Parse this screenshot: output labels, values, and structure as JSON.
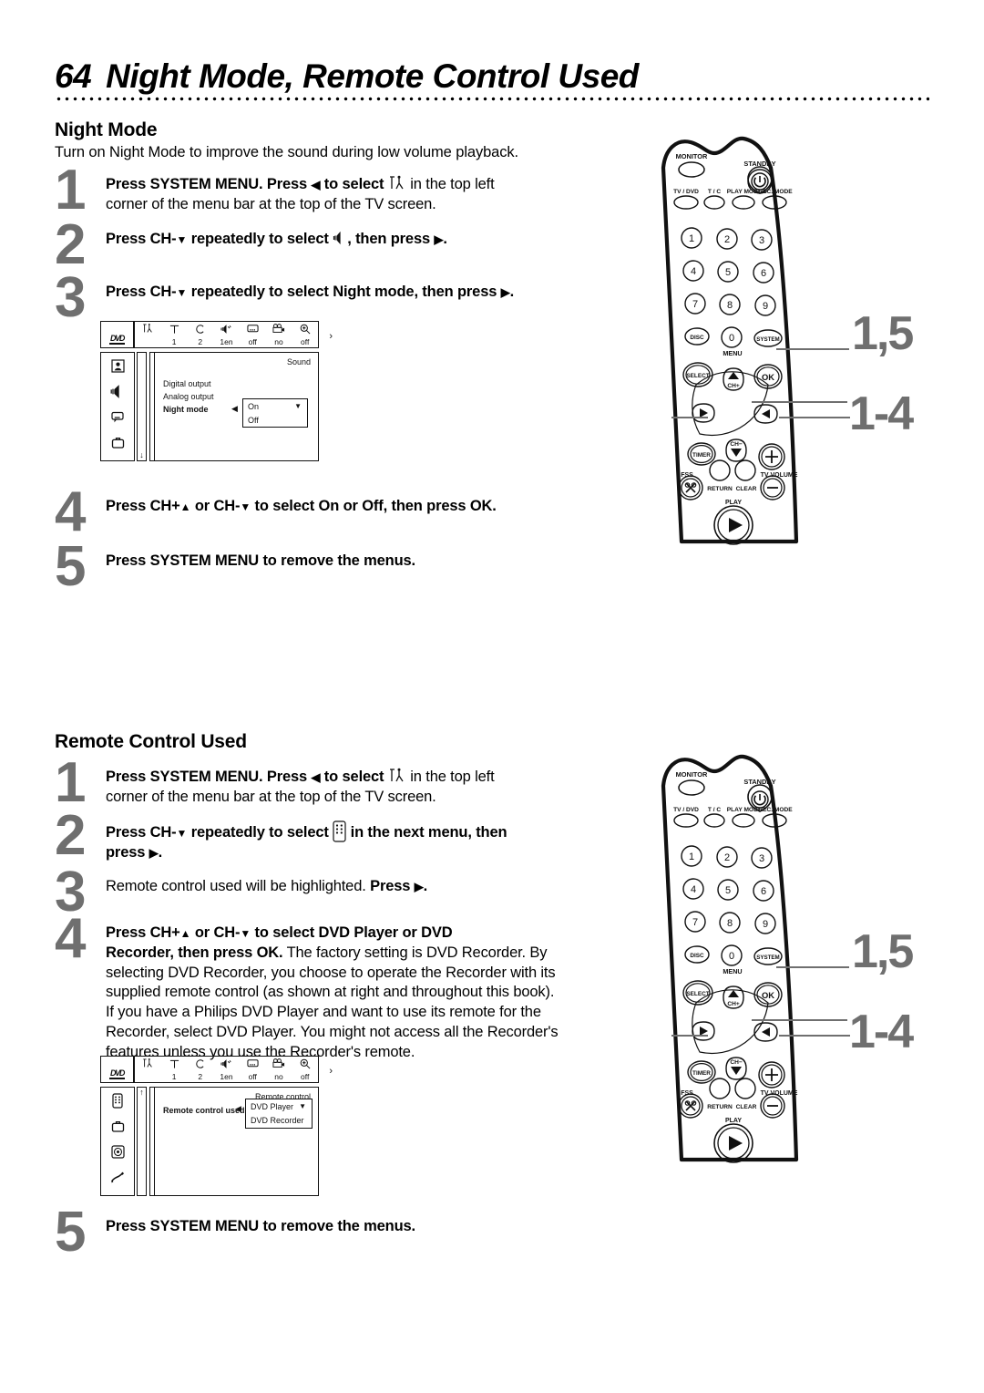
{
  "page": {
    "number": "64",
    "title": "Night Mode, Remote Control Used"
  },
  "sections": [
    {
      "id": "night_mode",
      "title": "Night Mode",
      "intro": "Turn on Night Mode to improve the sound during low volume playback."
    },
    {
      "id": "remote_control_used",
      "title": "Remote Control Used"
    }
  ],
  "night_mode_steps": {
    "s1_num": "1",
    "s1_a": "Press SYSTEM MENU. Press ",
    "s1_b": " to select ",
    "s1_c": " in the top left",
    "s1_d": "corner of the menu bar at the top of the TV screen.",
    "s2_num": "2",
    "s2_a": "Press CH-",
    "s2_b": " repeatedly to select ",
    "s2_c": ", then press ",
    "s2_d": ".",
    "s3_num": "3",
    "s3_a": "Press CH-",
    "s3_b": " repeatedly to select Night mode, then press ",
    "s3_c": ".",
    "s4_num": "4",
    "s4_a": "Press CH+",
    "s4_b": " or CH-",
    "s4_c": " to select On or Off, then press OK.",
    "s5_num": "5",
    "s5_a": "Press SYSTEM MENU",
    "s5_b": " to remove the menus."
  },
  "remote_used_steps": {
    "s1_num": "1",
    "s1_a": "Press SYSTEM MENU. Press ",
    "s1_b": " to select ",
    "s1_c": " in the top left",
    "s1_d": "corner of the menu bar at the top of the TV screen.",
    "s2_num": "2",
    "s2_a": "Press CH-",
    "s2_b": " repeatedly to select ",
    "s2_c": " in the next menu, then",
    "s2_d": "press ",
    "s2_e": ".",
    "s3_num": "3",
    "s3_a": "Remote control used will be highlighted. ",
    "s3_b": "Press ",
    "s3_c": ".",
    "s4_num": "4",
    "s4_a": "Press CH+",
    "s4_b": " or CH-",
    "s4_c": " to select DVD Player or DVD",
    "s4_d": "Recorder, then press OK.",
    "s4_e": " The factory setting is DVD Recorder. By selecting DVD Recorder, you choose to operate the Recorder with its supplied remote control (as shown at right and throughout this book). If you have a Philips DVD Player and want to use its remote for the Recorder, select DVD Player. You might not access all the Recorder's features unless you use the Recorder's remote.",
    "s5_num": "5",
    "s5_a": "Press SYSTEM MENU",
    "s5_b": " to remove the menus."
  },
  "tv_menu_sound": {
    "logo": "DVD",
    "bar_columns": [
      {
        "icon": "tools-icon",
        "value": ""
      },
      {
        "icon": "title-T-icon",
        "value": "1"
      },
      {
        "icon": "chapter-C-icon",
        "value": "2"
      },
      {
        "icon": "audio-language-icon",
        "value": "1en"
      },
      {
        "icon": "subtitle-icon",
        "value": "off"
      },
      {
        "icon": "camera-angle-icon",
        "value": "no"
      },
      {
        "icon": "zoom-icon",
        "value": "off"
      }
    ],
    "bar_more": "›",
    "sidebar_icons": [
      "picture-icon",
      "sound-speaker-icon",
      "language-bubble-icon",
      "features-box-icon"
    ],
    "sidebar_selected_index": 1,
    "scroll_top": "",
    "scroll_bottom": "↓",
    "heading": "Sound",
    "rows": [
      "Digital output",
      "Analog output",
      "Night mode"
    ],
    "selected_row": "Night mode",
    "select_arrow": "◀",
    "dropdown_options": [
      "On",
      "Off"
    ],
    "dropdown_caret": "▼"
  },
  "tv_menu_remote": {
    "logo": "DVD",
    "bar_columns": [
      {
        "icon": "tools-icon",
        "value": ""
      },
      {
        "icon": "title-T-icon",
        "value": "1"
      },
      {
        "icon": "chapter-C-icon",
        "value": "2"
      },
      {
        "icon": "audio-language-icon",
        "value": "1en"
      },
      {
        "icon": "subtitle-icon",
        "value": "off"
      },
      {
        "icon": "camera-angle-icon",
        "value": "no"
      },
      {
        "icon": "zoom-icon",
        "value": "off"
      }
    ],
    "bar_more": "›",
    "sidebar_icons": [
      "remote-control-icon",
      "features-box-icon",
      "disc-icon",
      "wrench-icon"
    ],
    "sidebar_selected_index": 0,
    "scroll_top": "↑",
    "scroll_bottom": "",
    "heading": "Remote control",
    "rows": [
      "Remote control used"
    ],
    "selected_row": "Remote control used",
    "select_arrow": "◀",
    "dropdown_options": [
      "DVD Player",
      "DVD Recorder"
    ],
    "dropdown_caret": "▼"
  },
  "remote": {
    "standby_label": "STANDBY",
    "monitor_label": "MONITOR",
    "row_labels": [
      "TV / DVD",
      "T / C",
      "PLAY MODE",
      "REC. MODE"
    ],
    "keys": [
      "1",
      "2",
      "3",
      "4",
      "5",
      "6",
      "7",
      "8",
      "9"
    ],
    "disc_label": "DISC",
    "zero_label": "0",
    "system_label": "SYSTEM",
    "menu_label": "MENU",
    "select_label": "SELECT",
    "ok_label": "OK",
    "ch_up_label": "CH+",
    "ch_down_label": "CH−",
    "timer_label": "TIMER",
    "fss_label": "FSS",
    "return_label": "RETURN",
    "clear_label": "CLEAR",
    "tv_volume_label": "TV VOLUME",
    "play_label": "PLAY",
    "plus_label": "+",
    "minus_label": "−"
  },
  "callouts": {
    "top_system": "1,5",
    "top_nav": "1-4",
    "bottom_system": "1,5",
    "bottom_nav": "1-4"
  },
  "colors": {
    "step_number_gray": "#6f6f6f",
    "ink": "#000000",
    "paper": "#ffffff"
  }
}
